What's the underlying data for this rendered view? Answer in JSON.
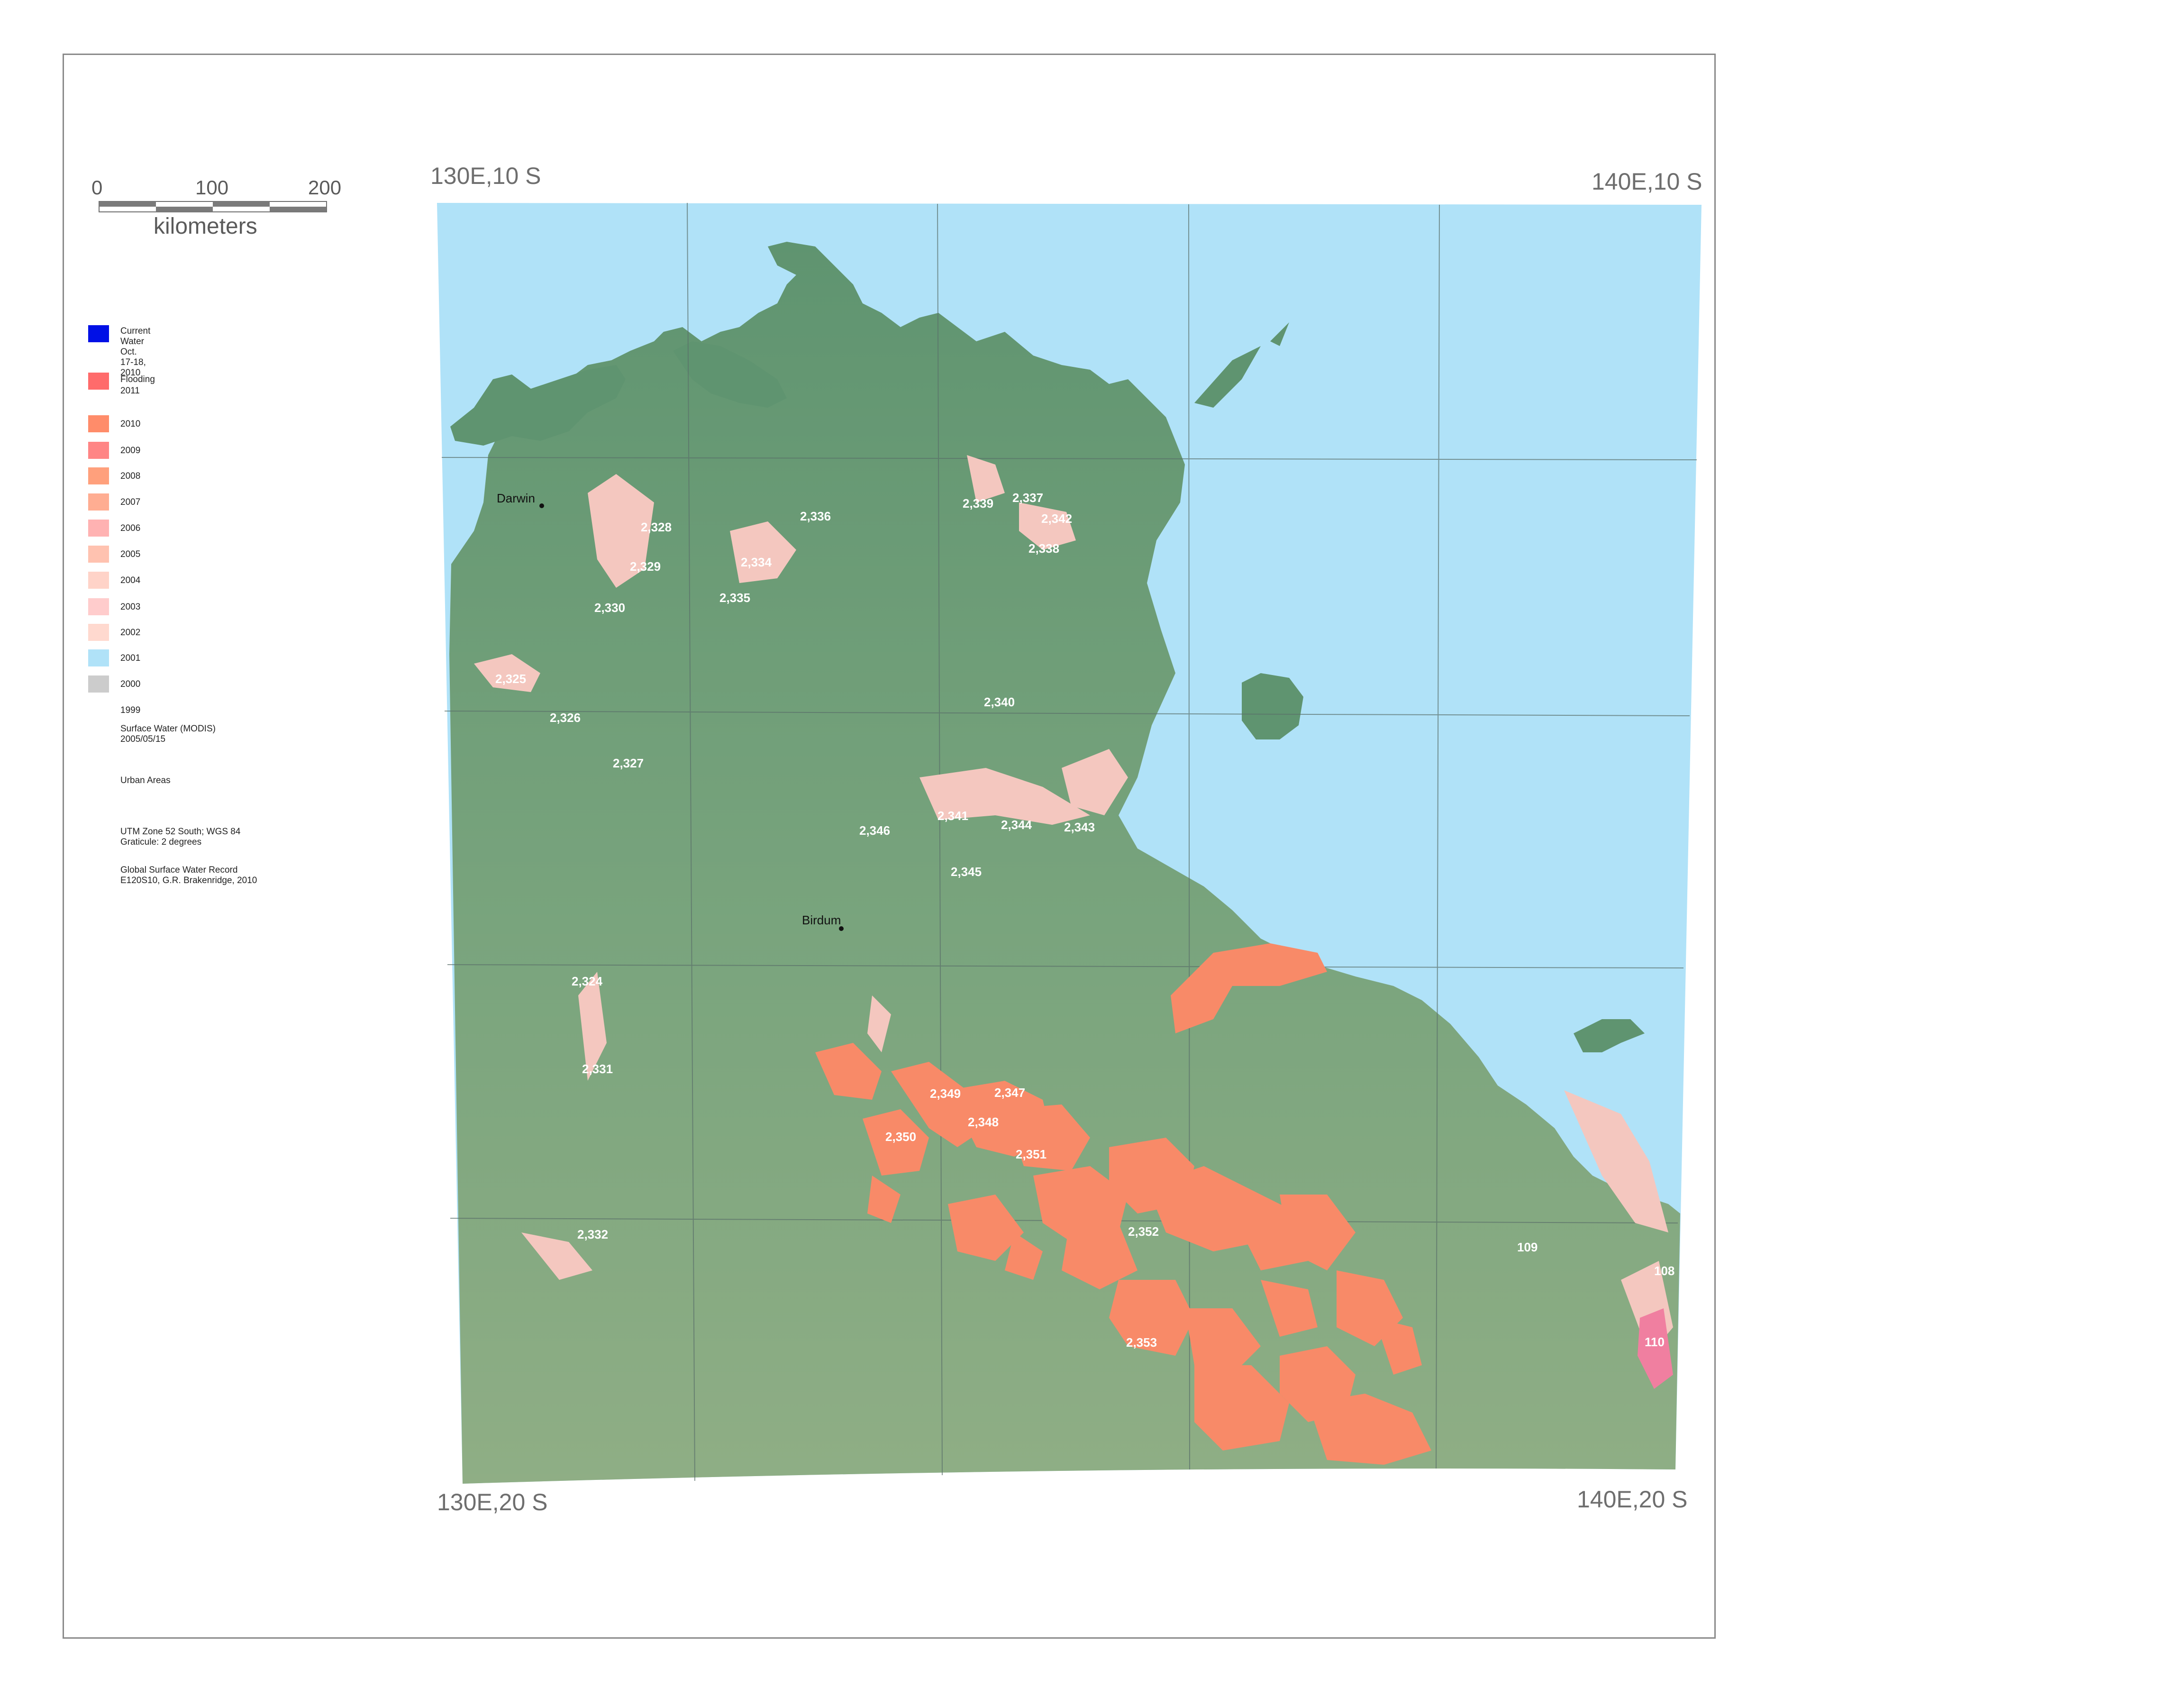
{
  "scale_bar": {
    "ticks": [
      "0",
      "100",
      "200"
    ],
    "units": "kilometers"
  },
  "corners": {
    "top_left": "130E,10 S",
    "top_right": "140E,10 S",
    "bottom_left": "130E,20 S",
    "bottom_right": "140E,20 S"
  },
  "legend": {
    "current_water": {
      "label": "Current  Water\nOct. 17-18, 2010",
      "color": "#0010e6"
    },
    "flooding_title": "Flooding",
    "years": [
      {
        "label": "2011",
        "color": "#ff6b6b"
      },
      {
        "label": "2010",
        "color": "#ff8c6a"
      },
      {
        "label": "2009",
        "color": "#ff8585"
      },
      {
        "label": "2008",
        "color": "#ffa07c"
      },
      {
        "label": "2007",
        "color": "#ffad92"
      },
      {
        "label": "2006",
        "color": "#ffb2b2"
      },
      {
        "label": "2005",
        "color": "#ffc2b0"
      },
      {
        "label": "2004",
        "color": "#ffd3c8"
      },
      {
        "label": "2003",
        "color": "#ffcccc"
      },
      {
        "label": "2002",
        "color": "#ffd9cf"
      },
      {
        "label": "2001",
        "color": "#b0e2f8"
      },
      {
        "label": "2000",
        "color": "#cccccc"
      },
      {
        "label": "1999",
        "color": ""
      }
    ],
    "surface_water": "Surface Water (MODIS)\n2005/05/15",
    "urban": "Urban Areas",
    "projection": "UTM Zone 52 South; WGS 84\nGraticule:  2 degrees",
    "credit": "Global Surface Water Record\nE120S10, G.R. Brakenridge, 2010"
  },
  "colors": {
    "ocean": "#b0e2f8",
    "land": "#6f9e79",
    "flood": "#f88a68",
    "flood_light": "#f4c7bf",
    "graticule": "#5a6f6a"
  },
  "cities": [
    {
      "name": "Darwin"
    },
    {
      "name": "Birdum"
    }
  ],
  "event_labels": [
    "2,328",
    "2,329",
    "2,330",
    "2,334",
    "2,335",
    "2,336",
    "2,339",
    "2,337",
    "2,342",
    "2,338",
    "2,325",
    "2,326",
    "2,327",
    "2,340",
    "2,341",
    "2,344",
    "2,343",
    "2,346",
    "2,345",
    "2,324",
    "2,331",
    "2,349",
    "2,347",
    "2,348",
    "2,350",
    "2,351",
    "2,332",
    "2,352",
    "109",
    "108",
    "2,353",
    "110"
  ]
}
